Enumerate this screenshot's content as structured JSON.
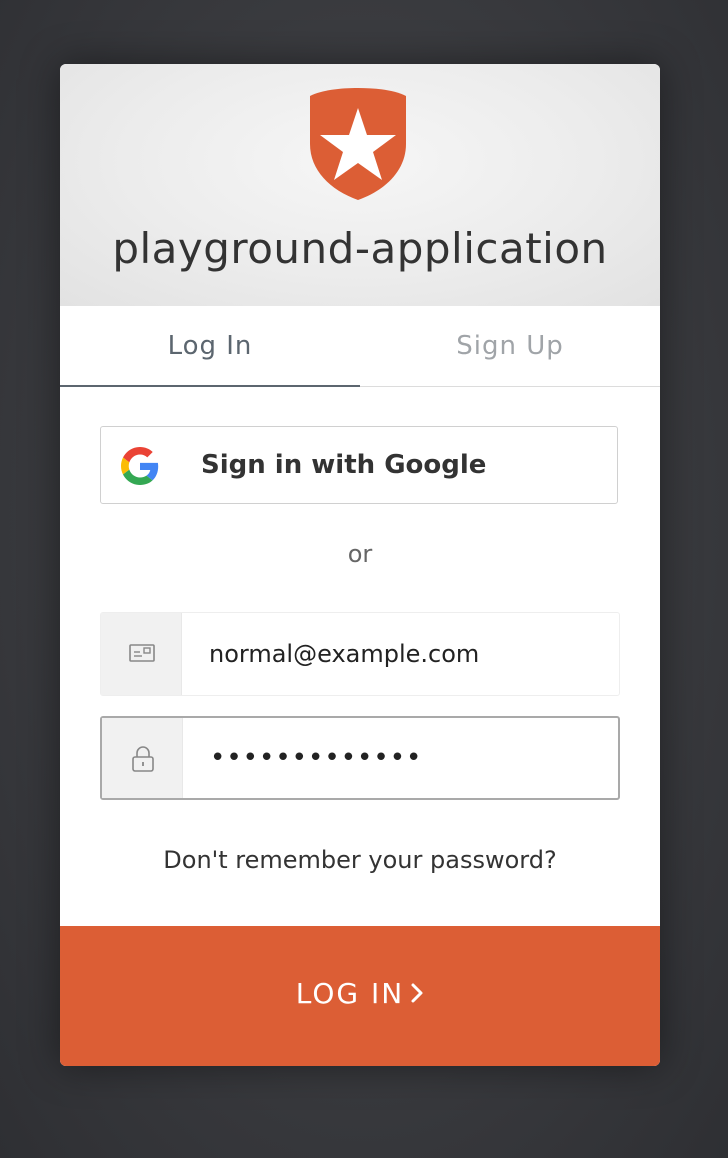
{
  "header": {
    "app_name": "playground-application",
    "logo_icon": "auth0-shield-star-logo",
    "logo_color": "#dc5e35"
  },
  "tabs": [
    {
      "label": "Log In",
      "active": true
    },
    {
      "label": "Sign Up",
      "active": false
    }
  ],
  "social": {
    "google_label": "Sign in with Google",
    "google_icon": "google-g-icon"
  },
  "divider_text": "or",
  "form": {
    "email": {
      "value": "normal@example.com",
      "icon": "email-icon"
    },
    "password": {
      "value": "•••••••••••••",
      "icon": "lock-icon"
    },
    "forgot_label": "Don't remember your password?"
  },
  "submit": {
    "label": "LOG IN",
    "icon": "chevron-right-icon",
    "color": "#dc5e35"
  }
}
